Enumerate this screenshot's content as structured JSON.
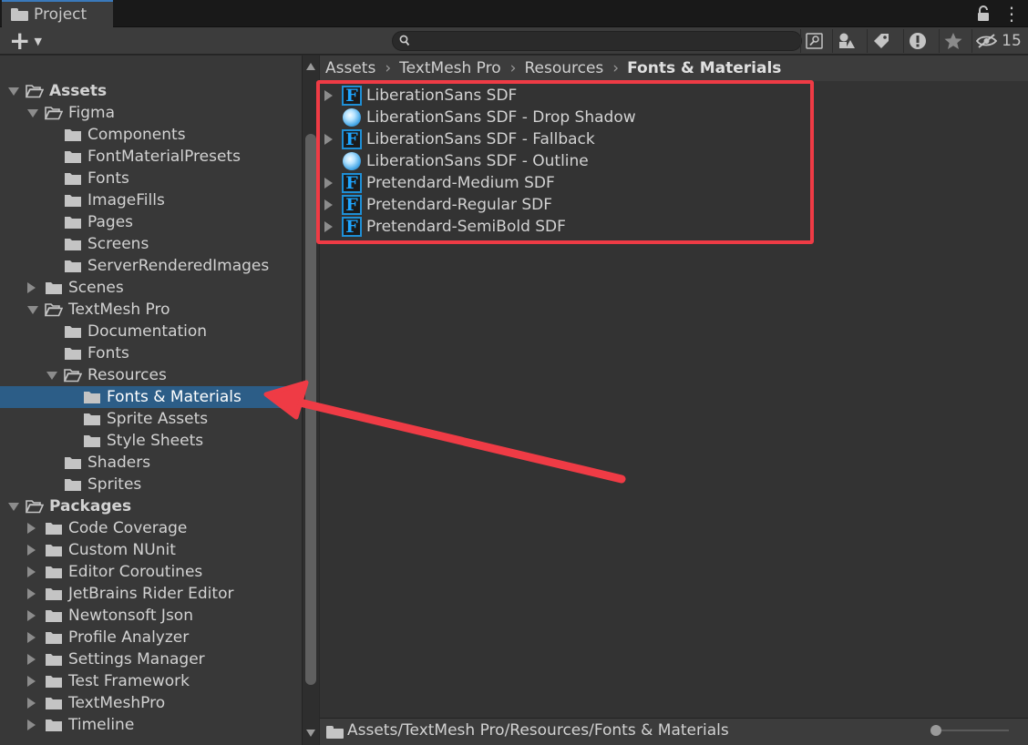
{
  "window": {
    "tab_title": "Project"
  },
  "toolbar": {
    "search_placeholder": "",
    "hidden_packages_count": "15"
  },
  "tree": {
    "items": [
      {
        "label": "Assets",
        "bold": true
      },
      {
        "label": "Figma"
      },
      {
        "label": "Components"
      },
      {
        "label": "FontMaterialPresets"
      },
      {
        "label": "Fonts"
      },
      {
        "label": "ImageFills"
      },
      {
        "label": "Pages"
      },
      {
        "label": "Screens"
      },
      {
        "label": "ServerRenderedImages"
      },
      {
        "label": "Scenes"
      },
      {
        "label": "TextMesh Pro"
      },
      {
        "label": "Documentation"
      },
      {
        "label": "Fonts"
      },
      {
        "label": "Resources"
      },
      {
        "label": "Fonts & Materials",
        "selected": true
      },
      {
        "label": "Sprite Assets"
      },
      {
        "label": "Style Sheets"
      },
      {
        "label": "Shaders"
      },
      {
        "label": "Sprites"
      },
      {
        "label": "Packages",
        "bold": true
      },
      {
        "label": "Code Coverage"
      },
      {
        "label": "Custom NUnit"
      },
      {
        "label": "Editor Coroutines"
      },
      {
        "label": "JetBrains Rider Editor"
      },
      {
        "label": "Newtonsoft Json"
      },
      {
        "label": "Profile Analyzer"
      },
      {
        "label": "Settings Manager"
      },
      {
        "label": "Test Framework"
      },
      {
        "label": "TextMeshPro"
      },
      {
        "label": "Timeline"
      }
    ]
  },
  "breadcrumb": {
    "items": [
      "Assets",
      "TextMesh Pro",
      "Resources"
    ],
    "current": "Fonts & Materials"
  },
  "assets": {
    "items": [
      {
        "label": "LiberationSans SDF",
        "kind": "font-asset",
        "icon_letter": "F"
      },
      {
        "label": "LiberationSans SDF - Drop Shadow",
        "kind": "material"
      },
      {
        "label": "LiberationSans SDF - Fallback",
        "kind": "font-asset",
        "icon_letter": "F"
      },
      {
        "label": "LiberationSans SDF - Outline",
        "kind": "material"
      },
      {
        "label": "Pretendard-Medium SDF",
        "kind": "font-asset",
        "icon_letter": "F"
      },
      {
        "label": "Pretendard-Regular SDF",
        "kind": "font-asset",
        "icon_letter": "F"
      },
      {
        "label": "Pretendard-SemiBold SDF",
        "kind": "font-asset",
        "icon_letter": "F"
      }
    ]
  },
  "statusbar": {
    "path": "Assets/TextMesh Pro/Resources/Fonts & Materials"
  },
  "colors": {
    "selection": "#2c5d87",
    "annotation_red": "#ef3b45",
    "font_icon_blue": "#1ea6ff"
  }
}
